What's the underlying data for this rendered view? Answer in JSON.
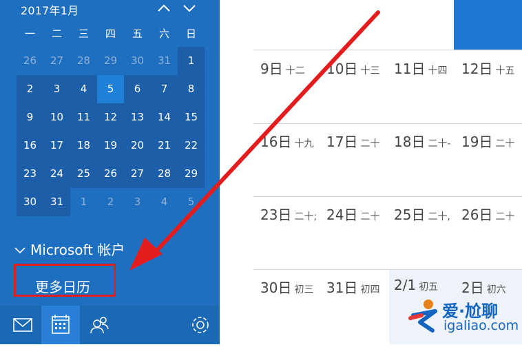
{
  "mini_calendar": {
    "header": "2017年1月",
    "weekdays": [
      "一",
      "二",
      "三",
      "四",
      "五",
      "六",
      "日"
    ],
    "weeks": [
      [
        "26",
        "27",
        "28",
        "29",
        "30",
        "31",
        "1"
      ],
      [
        "2",
        "3",
        "4",
        "5",
        "6",
        "7",
        "8"
      ],
      [
        "9",
        "10",
        "11",
        "12",
        "13",
        "14",
        "15"
      ],
      [
        "16",
        "17",
        "18",
        "19",
        "20",
        "21",
        "22"
      ],
      [
        "23",
        "24",
        "25",
        "26",
        "27",
        "28",
        "29"
      ],
      [
        "30",
        "31",
        "1",
        "2",
        "3",
        "4",
        "5"
      ]
    ],
    "today": "5"
  },
  "sidebar": {
    "account_label": "Microsoft 帐户",
    "more_calendars": "更多日历"
  },
  "bottom_bar": [
    "mail-icon",
    "calendar-icon",
    "people-icon",
    "gear-icon"
  ],
  "month_view": {
    "rows": [
      [
        {
          "day": "9日",
          "lunar": "十二"
        },
        {
          "day": "10日",
          "lunar": "十三"
        },
        {
          "day": "11日",
          "lunar": "十四"
        },
        {
          "day": "12日",
          "lunar": "十五"
        }
      ],
      [
        {
          "day": "16日",
          "lunar": "十九"
        },
        {
          "day": "17日",
          "lunar": "二十"
        },
        {
          "day": "18日",
          "lunar": "二十-"
        },
        {
          "day": "19日",
          "lunar": "二十"
        }
      ],
      [
        {
          "day": "23日",
          "lunar": "二十;"
        },
        {
          "day": "24日",
          "lunar": "二十"
        },
        {
          "day": "25日",
          "lunar": "二十,"
        },
        {
          "day": "26日",
          "lunar": "二十"
        }
      ],
      [
        {
          "day": "30日",
          "lunar": "初三"
        },
        {
          "day": "31日",
          "lunar": "初四"
        },
        {
          "day": "2/1",
          "lunar": "初五"
        },
        {
          "day": "2日",
          "lunar": "初六"
        }
      ]
    ]
  },
  "watermark": {
    "line1": "爱·尬聊",
    "line2": "igaliao.com"
  },
  "colors": {
    "sidebar_bg": "#1f6fc0",
    "annotation_red": "#e31d1d",
    "watermark_blue": "#1565c0"
  }
}
